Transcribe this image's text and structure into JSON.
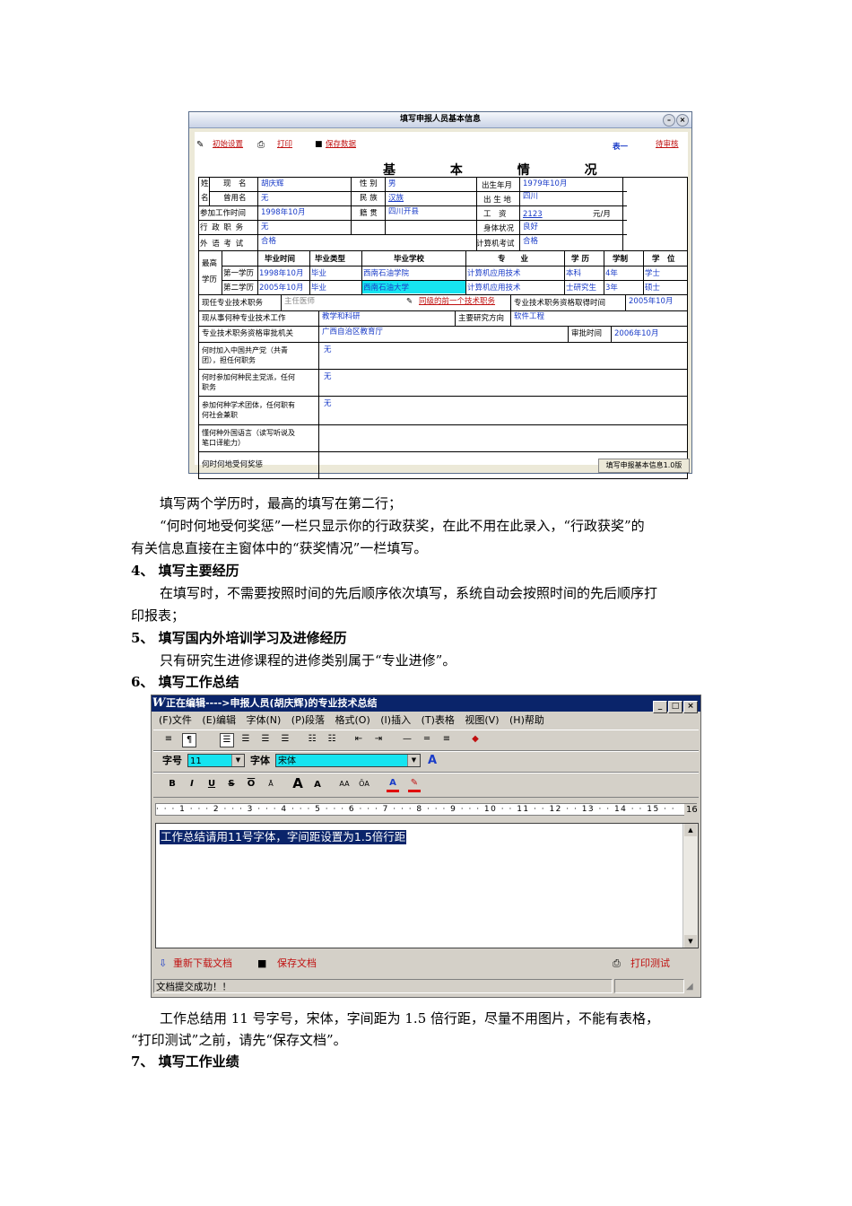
{
  "win1": {
    "title": "填写申报人员基本信息",
    "toolbar": {
      "init": "初始设置",
      "print": "打印",
      "save": "保存数据",
      "heading": "基 本 情 况",
      "table_no": "表一",
      "status": "待审核"
    },
    "labels": {
      "xing": "姓",
      "ming": "名",
      "xianming": "现　名",
      "cengyongming": "曾用名",
      "xingbie": "性 别",
      "minzu": "民 族",
      "birth": "出生年月",
      "birthplace": "出 生 地",
      "work_time": "参加工作时间",
      "jiguan": "籍 贯",
      "gongzi": "工　资",
      "admin_post": "行 政 职 务",
      "health": "身体状况",
      "foreign_exam": "外 语 考 试",
      "computer_exam": "计算机考试",
      "highest": "最高",
      "xueli": "学历",
      "edu1": "第一学历",
      "edu2": "第二学历",
      "tech_post": "现任专业技术职务",
      "tech_date": "专业技术职务资格取得时间",
      "work_field": "现从事何种专业技术工作",
      "research": "主要研究方向",
      "approver": "专业技术职务资格审批机关",
      "approve_time": "审批时间",
      "party1": "何时加入中国共产党（共青",
      "party2": "团），担任何职务",
      "dem1": "何时参加何种民主党派，任何",
      "dem2": "职务",
      "soc1": "参加何种学术团体，任何职有",
      "soc2": "何社会兼职",
      "lang1": "懂何种外国语言（读写听说及",
      "lang2": "笔口译能力）",
      "awards": "何时何地受何奖惩",
      "unit": "元/月",
      "prev_post": "同级的前一个技术职务"
    },
    "edu_headers": [
      "毕业时间",
      "毕业类型",
      "毕业学校",
      "专　　业",
      "学 历",
      "学制",
      "学　位"
    ],
    "edu_rows": [
      [
        "1998年10月",
        "毕业",
        "西南石油学院",
        "计算机应用技术",
        "本科",
        "4年",
        "学士"
      ],
      [
        "2005年10月",
        "毕业",
        "西南石油大学",
        "计算机应用技术",
        "士研究生",
        "3年",
        "硕士"
      ]
    ],
    "values": {
      "xianming": "胡庆辉",
      "cengyongming": "无",
      "xingbie": "男",
      "minzu": "汉族",
      "birth": "1979年10月",
      "birthplace": "四川",
      "work_time": "1998年10月",
      "jiguan": "四川开县",
      "gongzi": "2123",
      "admin_post": "无",
      "health": "良好",
      "foreign_exam": "合格",
      "computer_exam": "合格",
      "tech_post": "主任医师",
      "tech_date": "2005年10月",
      "work_field": "教学和科研",
      "research": "软件工程",
      "approver": "广西自治区教育厅",
      "approve_time": "2006年10月",
      "party": "无",
      "dem": "无",
      "soc": "无"
    },
    "statusbar": "填写申报基本信息1.0版"
  },
  "paragraphs": {
    "p1": "填写两个学历时，最高的填写在第二行；",
    "p2a": "“何时何地受何奖惩”一栏只显示你的行政获奖，在此不用在此录入，“行政获奖”的",
    "p2b": "有关信息直接在主窗体中的“获奖情况”一栏填写。",
    "h4": "4、 填写主要经历",
    "p3a": "在填写时，不需要按照时间的先后顺序依次填写，系统自动会按照时间的先后顺序打",
    "p3b": "印报表；",
    "h5": "5、 填写国内外培训学习及进修经历",
    "p4": "只有研究生进修课程的进修类别属于“专业进修”。",
    "h6": "6、 填写工作总结",
    "p5a": "工作总结用 11 号字号，宋体，字间距为 1.5 倍行距，尽量不用图片，不能有表格，",
    "p5b": "“打印测试”之前，请先“保存文档”。",
    "h7": "7、 填写工作业绩"
  },
  "win2": {
    "title": "正在编辑---->申报人员(胡庆辉)的专业技术总结",
    "menu": [
      "(F)文件",
      "(E)编辑",
      "字体(N)",
      "(P)段落",
      "格式(O)",
      "(I)插入",
      "(T)表格",
      "视图(V)",
      "(H)帮助"
    ],
    "font_size_label": "字号",
    "font_size": "11",
    "font_name_label": "字体",
    "font_name": "宋体",
    "ruler": "·  ·  ·  1  ·  ·  ·  2  ·  ·  ·  3  ·  ·  ·  4  ·  ·  ·  5  ·  ·  ·  6  ·  ·  ·  7  ·  ·  ·  8  ·  ·  ·  9  ·  ·  ·  10  ·  ·  11  ·  ·  12  ·  ·  13  ·  ·  14  ·  ·  15  ·  ·",
    "ruler_end": "16",
    "editor_text": "工作总结请用11号字体，字间距设置为1.5倍行距",
    "reload": "重新下载文档",
    "save": "保存文档",
    "print_test": "打印测试",
    "status": "文档提交成功！！"
  }
}
